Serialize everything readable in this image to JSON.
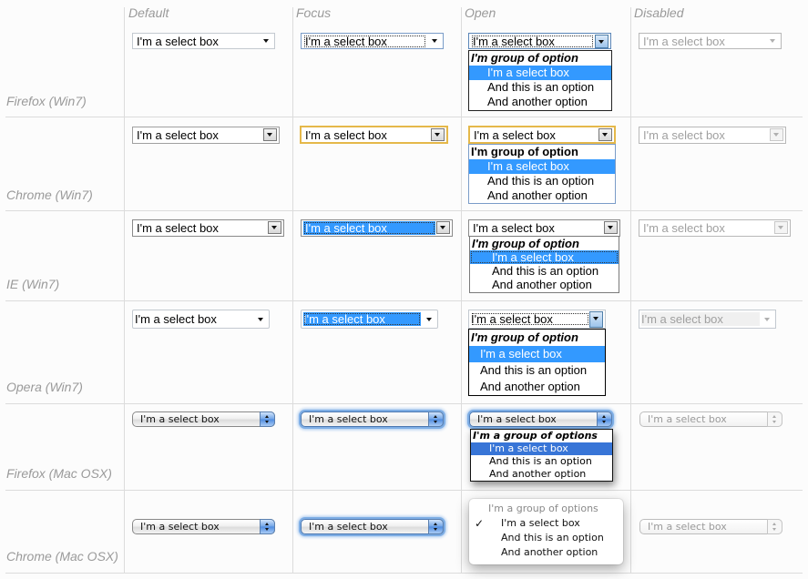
{
  "columns": [
    "Default",
    "Focus",
    "Open",
    "Disabled"
  ],
  "rows": [
    {
      "label": "Firefox (Win7)"
    },
    {
      "label": "Chrome (Win7)"
    },
    {
      "label": "IE (Win7)"
    },
    {
      "label": "Opera (Win7)"
    },
    {
      "label": "Firefox (Mac OSX)"
    },
    {
      "label": "Chrome (Mac OSX)"
    }
  ],
  "select_value": "I'm a select box",
  "win_options": {
    "group": "I'm group of option",
    "items": [
      "I'm a select box",
      "And this is an option",
      "And another option"
    ]
  },
  "mac_options": {
    "group": "I'm a group of options",
    "items": [
      "I'm a select box",
      "And this is an option",
      "And another option"
    ]
  },
  "checkmark": "✓",
  "colors": {
    "win_highlight": "#3399ff",
    "mac_highlight": "#3875d7",
    "chrome_focus": "#e5b84a"
  }
}
